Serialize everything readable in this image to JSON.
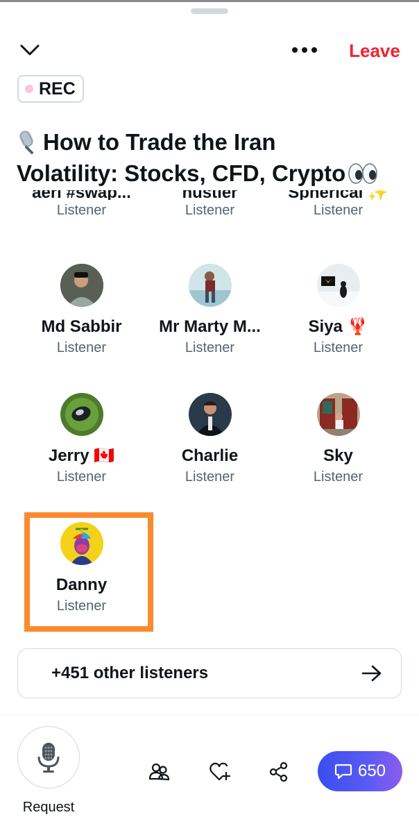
{
  "header": {
    "collapse_icon": "chevron-down-icon",
    "more_icon": "more-horizontal-icon",
    "leave_label": "Leave",
    "leave_color": "#f4212e"
  },
  "rec_badge": {
    "label": "REC",
    "dot_color": "#f9c8dc"
  },
  "space": {
    "title_line1": "How to Trade the Iran",
    "title_line2": "Volatility: Stocks, CFD, Crypto",
    "title_prefix_icon": "microphone-emoji",
    "title_suffix_icon": "eyes-emoji"
  },
  "listeners": {
    "cut_row": [
      {
        "name": "aeri #swap...",
        "role": "Listener"
      },
      {
        "name": "hustler",
        "role": "Listener"
      },
      {
        "name": "Spherical ✨",
        "role": "Listener"
      }
    ],
    "rows": [
      [
        {
          "name": "Md Sabbir",
          "role": "Listener",
          "avatar": "photo-avatar"
        },
        {
          "name": "Mr Marty M...",
          "role": "Listener",
          "avatar": "photo-avatar"
        },
        {
          "name": "Siya 🦞",
          "role": "Listener",
          "avatar": "photo-avatar"
        }
      ],
      [
        {
          "name": "Jerry 🇨🇦",
          "role": "Listener",
          "avatar": "photo-avatar"
        },
        {
          "name": "Charlie",
          "role": "Listener",
          "avatar": "photo-avatar"
        },
        {
          "name": "Sky",
          "role": "Listener",
          "avatar": "photo-avatar"
        }
      ],
      [
        {
          "name": "Danny",
          "role": "Listener",
          "avatar": "cartoon-avatar",
          "highlighted": true
        }
      ]
    ],
    "highlight_color": "#fb8a2e"
  },
  "other_listeners": {
    "label": "+451 other listeners",
    "icon": "arrow-right-icon"
  },
  "bottom_bar": {
    "request_label": "Request",
    "request_icon": "microphone-icon",
    "people_icon": "people-icon",
    "like_icon": "heart-plus-icon",
    "share_icon": "share-icon",
    "chat_icon": "chat-bubble-icon",
    "chat_count": "650",
    "chat_gradient": [
      "#3a4df0",
      "#8c5cf0"
    ]
  }
}
